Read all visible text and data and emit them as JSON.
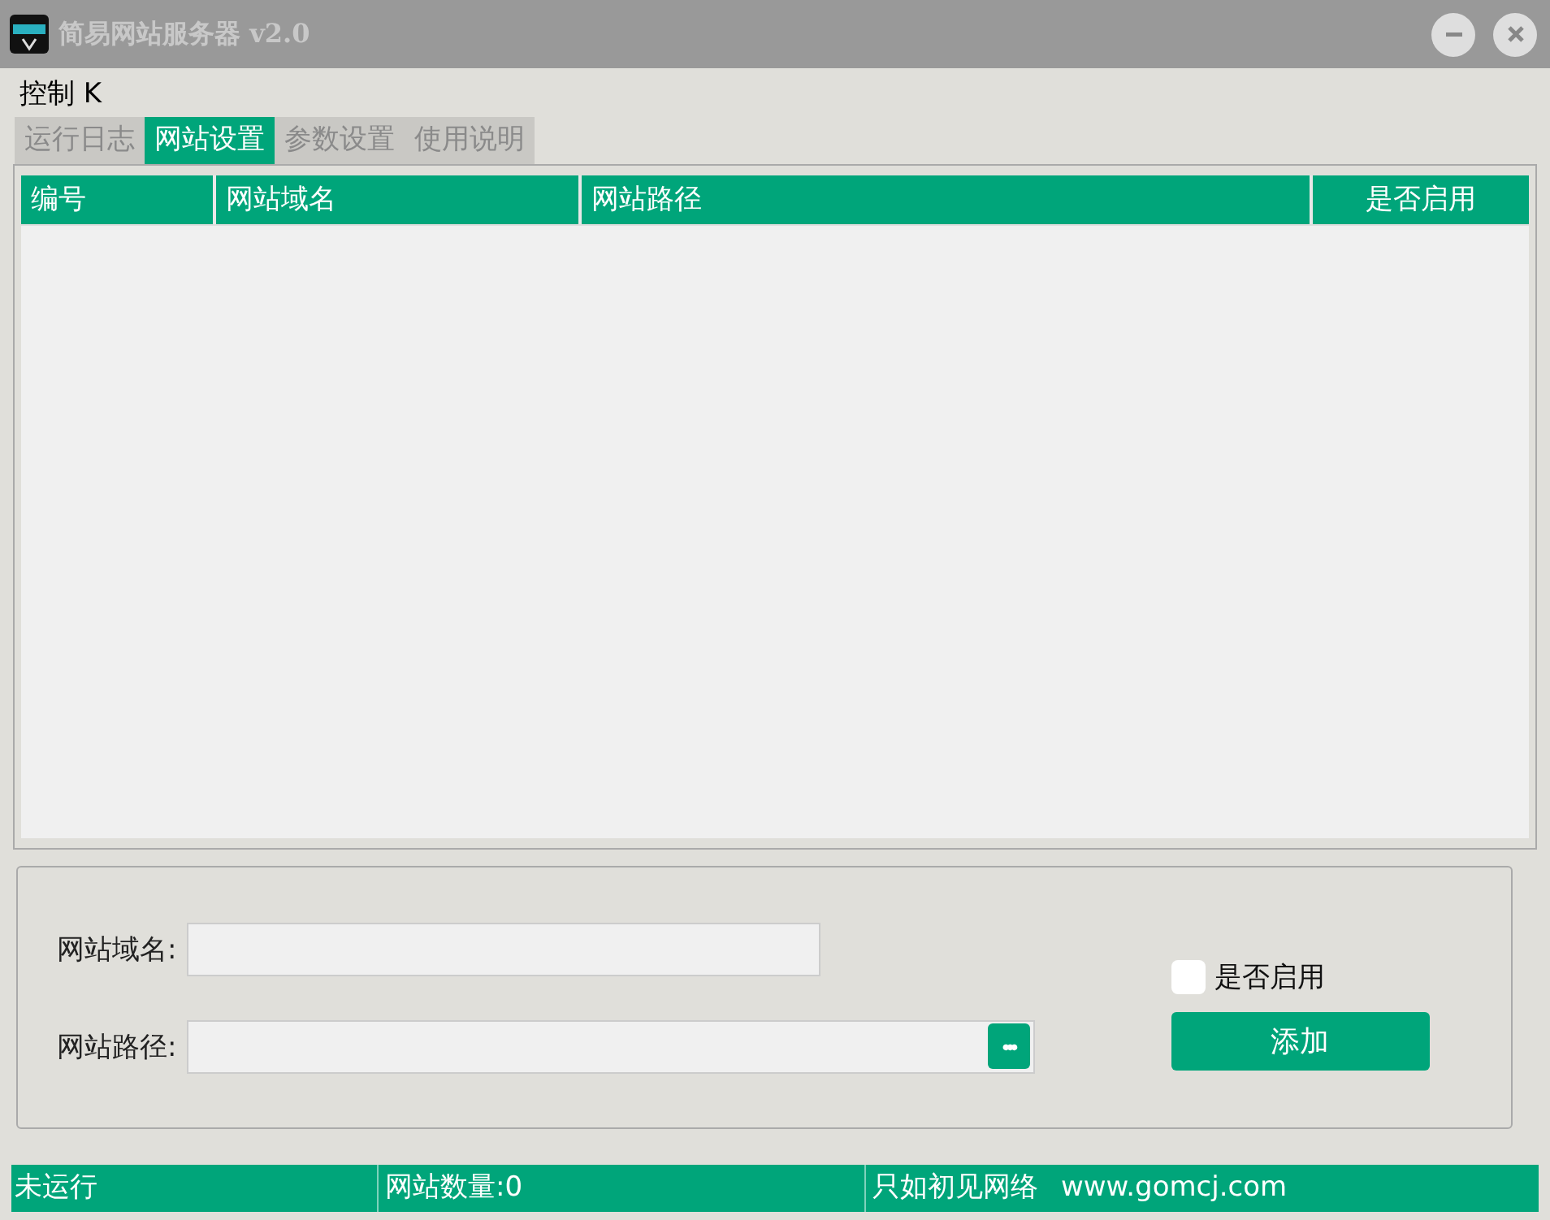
{
  "window": {
    "title": "简易网站服务器 v2.0"
  },
  "menu": [
    "控制 K"
  ],
  "tabs": [
    {
      "label": "运行日志",
      "selected": false
    },
    {
      "label": "网站设置",
      "selected": true
    },
    {
      "label": "参数设置",
      "selected": false
    },
    {
      "label": "使用说明",
      "selected": false
    }
  ],
  "table": {
    "columns": [
      "编号",
      "网站域名",
      "网站路径",
      "是否启用"
    ]
  },
  "form": {
    "domain_label": "网站域名:",
    "path_label": "网站路径:",
    "browse_button": "•••",
    "enabled": {
      "label": "是否启用",
      "checked": false
    },
    "add_button": "添加"
  },
  "status_bar": [
    "未运行",
    "网站数量:0",
    "只如初见网络",
    "www.gomcj.com"
  ]
}
